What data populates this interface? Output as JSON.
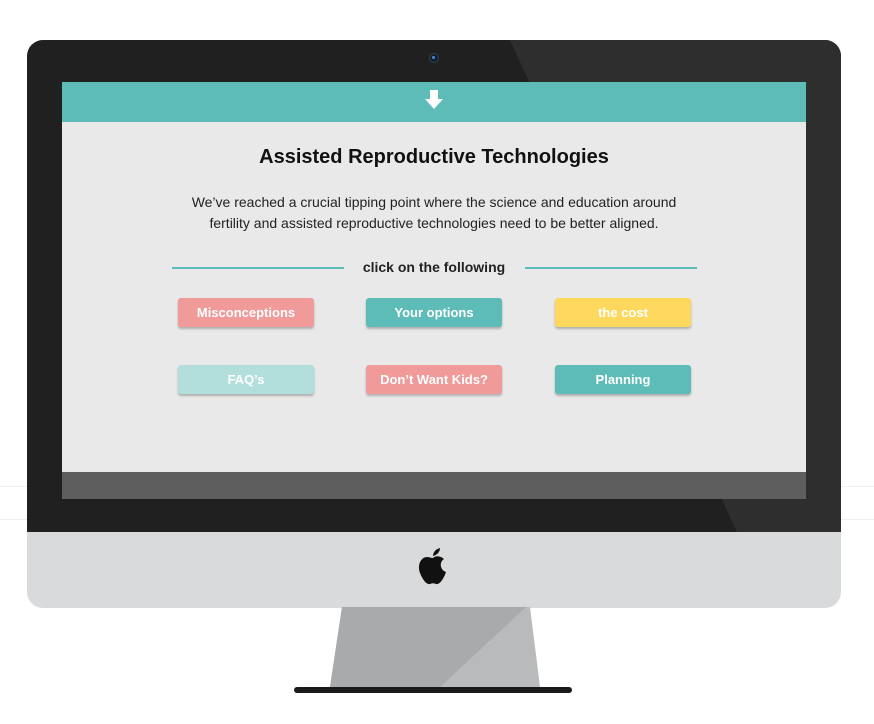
{
  "page": {
    "title": "Assisted Reproductive Technologies",
    "description": "We’ve reached a crucial tipping point where the science and education around fertility and assisted reproductive technologies need to be better aligned.",
    "divider_text": "click on the following"
  },
  "icons": {
    "scroll": "down-arrow-icon",
    "brand": "apple-logo-icon",
    "camera": "camera-icon"
  },
  "buttons": [
    {
      "label": "Misconceptions",
      "color": "#f09a9a"
    },
    {
      "label": "Your options",
      "color": "#5dbcb7"
    },
    {
      "label": "the cost",
      "color": "#fed85d"
    },
    {
      "label": "FAQ’s",
      "color": "#b2dfdc"
    },
    {
      "label": "Don’t Want Kids?",
      "color": "#f09a9a"
    },
    {
      "label": "Planning",
      "color": "#5dbcb7"
    }
  ],
  "colors": {
    "accent": "#5dbcb7",
    "screen_bg": "#e9e9e9",
    "bezel": "#202020",
    "chin": "#d9dadb"
  }
}
